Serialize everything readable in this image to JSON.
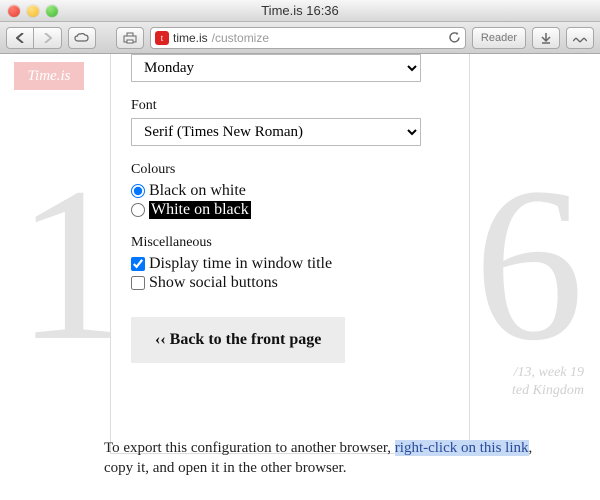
{
  "window": {
    "title": "Time.is 16:36"
  },
  "url": {
    "domain": "time.is",
    "path": "/customize"
  },
  "toolbar": {
    "reader": "Reader"
  },
  "background": {
    "logo": "Time.is",
    "digit_left": "1",
    "digit_right": "6",
    "meta_line1": "/13, week 19",
    "meta_line2": "ted Kingdom"
  },
  "form": {
    "weekday_select": "Monday",
    "font_label": "Font",
    "font_select": "Serif (Times New Roman)",
    "colours_label": "Colours",
    "colour_option1": "Black on white",
    "colour_option2": "White on black",
    "misc_label": "Miscellaneous",
    "misc_option1": "Display time in window title",
    "misc_option2": "Show social buttons",
    "back_button": "‹‹ Back to the front page"
  },
  "export": {
    "before": "To export this configuration to another browser, ",
    "link1": "right-click on this link",
    "after": ", copy it, and open it in the other browser."
  }
}
